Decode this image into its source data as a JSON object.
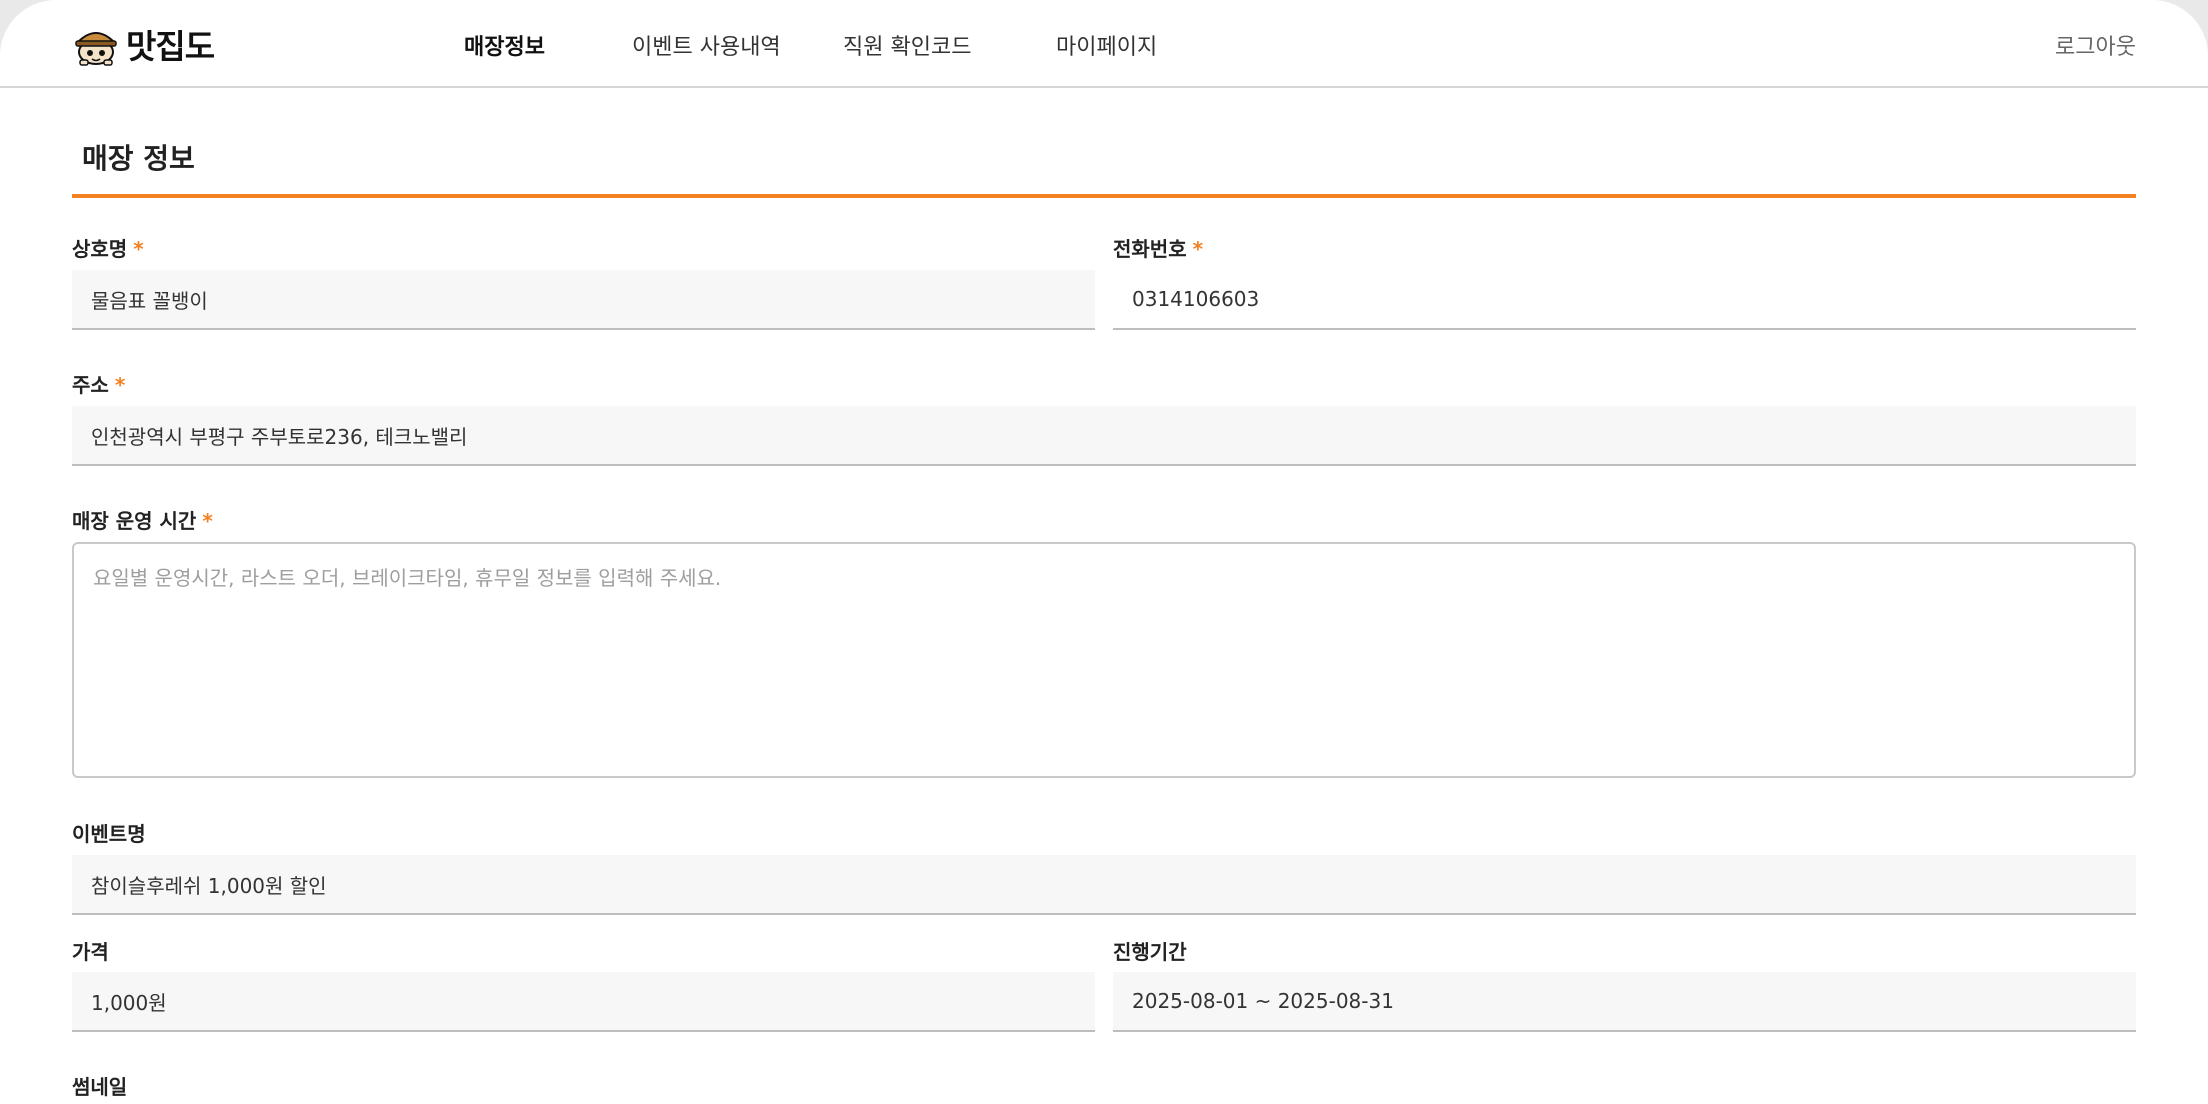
{
  "header": {
    "logo_text": "맛집도",
    "nav": [
      {
        "label": "매장정보",
        "active": true
      },
      {
        "label": "이벤트 사용내역",
        "active": false
      },
      {
        "label": "직원 확인코드",
        "active": false
      },
      {
        "label": "마이페이지",
        "active": false
      }
    ],
    "logout_label": "로그아웃"
  },
  "page": {
    "title": "매장 정보"
  },
  "form": {
    "required_mark": "*",
    "store_name": {
      "label": "상호명",
      "value": "물음표 꼴뱅이"
    },
    "phone": {
      "label": "전화번호",
      "value": "0314106603"
    },
    "address": {
      "label": "주소",
      "value": "인천광역시 부평구 주부토로236, 테크노밸리"
    },
    "hours": {
      "label": "매장 운영 시간",
      "value": "",
      "placeholder": "요일별 운영시간, 라스트 오더, 브레이크타임, 휴무일 정보를 입력해 주세요."
    },
    "event_name": {
      "label": "이벤트명",
      "value": "참이슬후레쉬 1,000원 할인"
    },
    "price": {
      "label": "가격",
      "value": "1,000원"
    },
    "period": {
      "label": "진행기간",
      "value": "2025-08-01 ~ 2025-08-31"
    },
    "thumbnail": {
      "label": "썸네일"
    }
  },
  "colors": {
    "accent": "#f38121",
    "field_bg": "#f7f7f7",
    "border": "#bdbdbd"
  },
  "icons": {
    "logo": "mascot-with-hat-icon"
  }
}
